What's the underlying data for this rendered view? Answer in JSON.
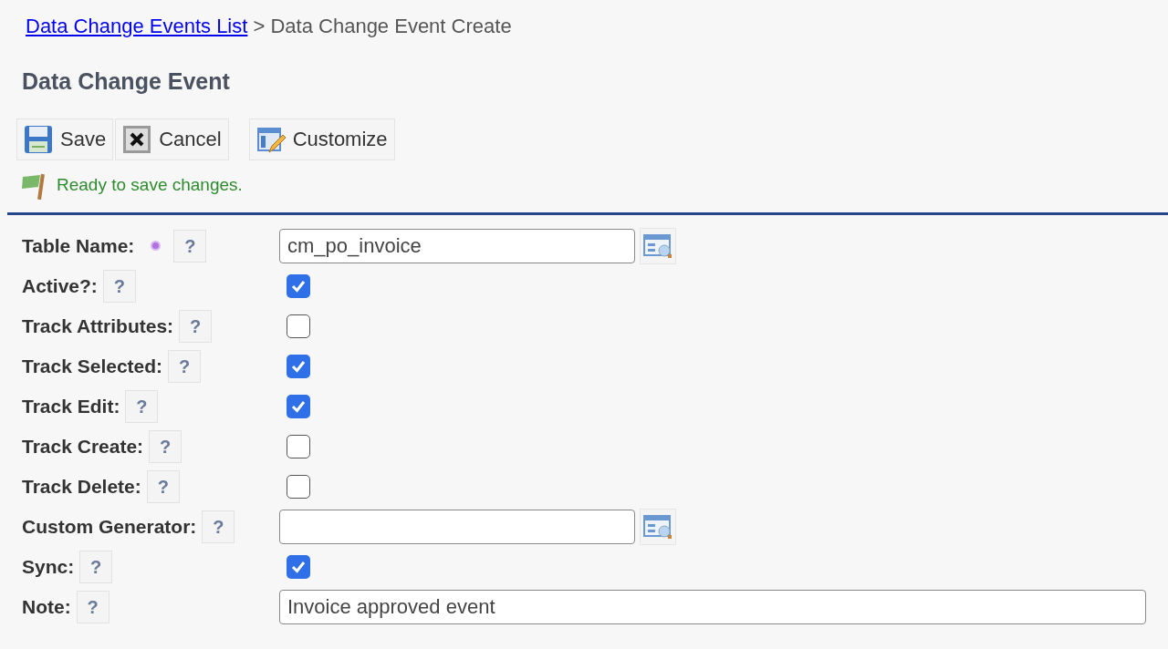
{
  "breadcrumb": {
    "link": "Data Change Events List",
    "separator": ">",
    "current": "Data Change Event Create"
  },
  "heading": "Data Change Event",
  "toolbar": [
    {
      "kind": "save",
      "label": "Save"
    },
    {
      "kind": "cancel",
      "label": "Cancel"
    },
    {
      "kind": "customize",
      "label": "Customize"
    }
  ],
  "status": "Ready to save changes.",
  "fields": [
    {
      "kind": "lookup",
      "label": "Table Name:",
      "required": true,
      "help": "?",
      "value": "cm_po_invoice"
    },
    {
      "kind": "checkbox",
      "label": "Active?:",
      "help": "?",
      "checked": true
    },
    {
      "kind": "checkbox",
      "label": "Track Attributes:",
      "help": "?",
      "checked": false
    },
    {
      "kind": "checkbox",
      "label": "Track Selected:",
      "help": "?",
      "checked": true
    },
    {
      "kind": "checkbox",
      "label": "Track Edit:",
      "help": "?",
      "checked": true
    },
    {
      "kind": "checkbox",
      "label": "Track Create:",
      "help": "?",
      "checked": false
    },
    {
      "kind": "checkbox",
      "label": "Track Delete:",
      "help": "?",
      "checked": false
    },
    {
      "kind": "lookup",
      "label": "Custom Generator:",
      "help": "?"
    },
    {
      "kind": "checkbox",
      "label": "Sync:",
      "help": "?",
      "checked": true
    },
    {
      "kind": "text",
      "label": "Note:",
      "help": "?",
      "value": "Invoice approved event"
    }
  ]
}
